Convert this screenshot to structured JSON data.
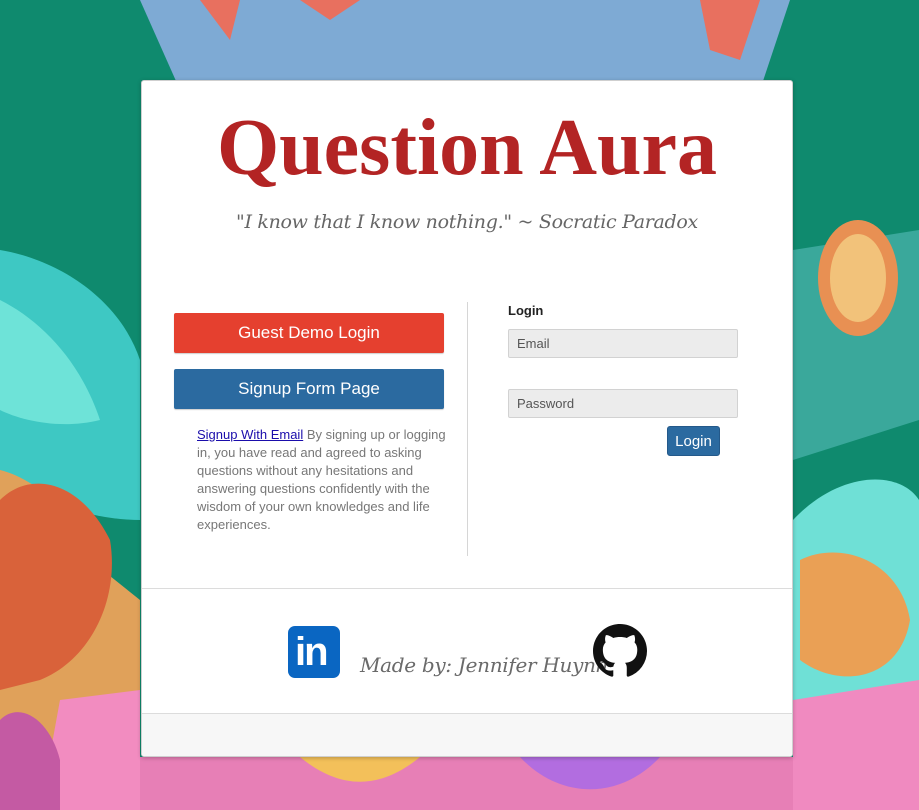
{
  "header": {
    "title": "Question Aura",
    "quote": "\"I know that I know nothing.\" ~ Socratic Paradox"
  },
  "left_panel": {
    "guest_button": "Guest Demo Login",
    "signup_button": "Signup Form Page",
    "signup_link": "Signup With Email",
    "terms_text": " By signing up or logging in, you have read and agreed to asking questions without any hesitations and answering questions confidently with the wisdom of your own knowledges and life experiences."
  },
  "login_form": {
    "heading": "Login",
    "email_placeholder": "Email",
    "password_placeholder": "Password",
    "login_button": "Login"
  },
  "footer": {
    "linkedin_icon": "linkedin-icon",
    "linkedin_text": "in",
    "made_by": "Made by: Jennifer Huynh",
    "github_icon": "github-icon"
  },
  "colors": {
    "title": "#b32424",
    "guest_button": "#e5402f",
    "primary_button": "#2b6aa0",
    "background": "#0f8a6e"
  }
}
